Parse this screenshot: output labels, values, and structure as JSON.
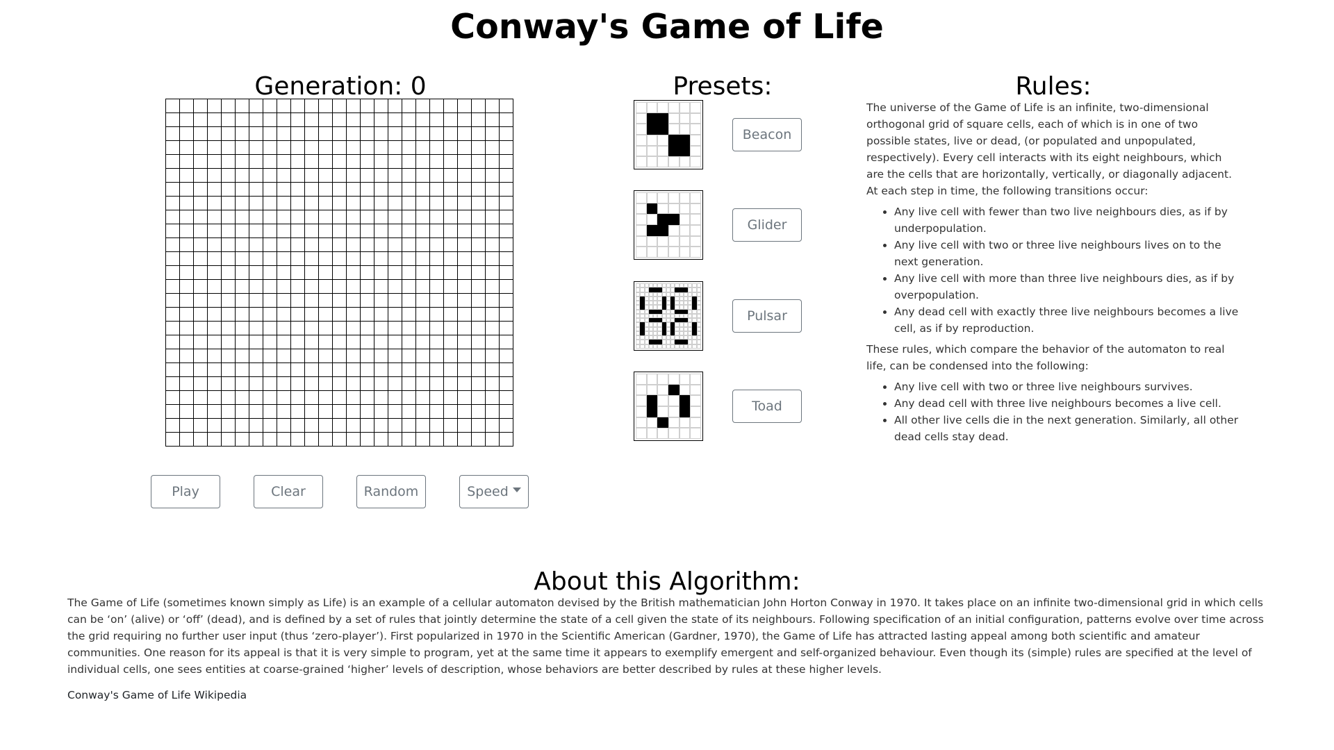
{
  "page": {
    "title": "Conway's Game of Life"
  },
  "game": {
    "generation_heading": "Generation: 0",
    "grid_rows": 25,
    "grid_cols": 25,
    "live_cells": []
  },
  "controls": {
    "play_label": "Play",
    "clear_label": "Clear",
    "random_label": "Random",
    "speed_label": "Speed"
  },
  "presets": {
    "heading": "Presets:",
    "items": [
      {
        "label": "Beacon",
        "rows": 6,
        "cols": 6,
        "cells": [
          [
            1,
            1
          ],
          [
            1,
            2
          ],
          [
            2,
            1
          ],
          [
            2,
            2
          ],
          [
            3,
            3
          ],
          [
            3,
            4
          ],
          [
            4,
            3
          ],
          [
            4,
            4
          ]
        ]
      },
      {
        "label": "Glider",
        "rows": 6,
        "cols": 6,
        "cells": [
          [
            1,
            1
          ],
          [
            2,
            2
          ],
          [
            2,
            3
          ],
          [
            3,
            1
          ],
          [
            3,
            2
          ]
        ]
      },
      {
        "label": "Pulsar",
        "rows": 15,
        "cols": 15,
        "cells": [
          [
            1,
            3
          ],
          [
            1,
            4
          ],
          [
            1,
            5
          ],
          [
            1,
            9
          ],
          [
            1,
            10
          ],
          [
            1,
            11
          ],
          [
            3,
            1
          ],
          [
            3,
            6
          ],
          [
            3,
            8
          ],
          [
            3,
            13
          ],
          [
            4,
            1
          ],
          [
            4,
            6
          ],
          [
            4,
            8
          ],
          [
            4,
            13
          ],
          [
            5,
            1
          ],
          [
            5,
            6
          ],
          [
            5,
            8
          ],
          [
            5,
            13
          ],
          [
            6,
            3
          ],
          [
            6,
            4
          ],
          [
            6,
            5
          ],
          [
            6,
            9
          ],
          [
            6,
            10
          ],
          [
            6,
            11
          ],
          [
            8,
            3
          ],
          [
            8,
            4
          ],
          [
            8,
            5
          ],
          [
            8,
            9
          ],
          [
            8,
            10
          ],
          [
            8,
            11
          ],
          [
            9,
            1
          ],
          [
            9,
            6
          ],
          [
            9,
            8
          ],
          [
            9,
            13
          ],
          [
            10,
            1
          ],
          [
            10,
            6
          ],
          [
            10,
            8
          ],
          [
            10,
            13
          ],
          [
            11,
            1
          ],
          [
            11,
            6
          ],
          [
            11,
            8
          ],
          [
            11,
            13
          ],
          [
            13,
            3
          ],
          [
            13,
            4
          ],
          [
            13,
            5
          ],
          [
            13,
            9
          ],
          [
            13,
            10
          ],
          [
            13,
            11
          ]
        ]
      },
      {
        "label": "Toad",
        "rows": 6,
        "cols": 6,
        "cells": [
          [
            1,
            3
          ],
          [
            2,
            1
          ],
          [
            2,
            4
          ],
          [
            3,
            1
          ],
          [
            3,
            4
          ],
          [
            4,
            2
          ]
        ]
      }
    ]
  },
  "rules": {
    "heading": "Rules:",
    "intro": "The universe of the Game of Life is an infinite, two-dimensional orthogonal grid of square cells, each of which is in one of two possible states, live or dead, (or populated and unpopulated, respectively). Every cell interacts with its eight neighbours, which are the cells that are horizontally, vertically, or diagonally adjacent. At each step in time, the following transitions occur:",
    "list1": [
      "Any live cell with fewer than two live neighbours dies, as if by underpopulation.",
      "Any live cell with two or three live neighbours lives on to the next generation.",
      "Any live cell with more than three live neighbours dies, as if by overpopulation.",
      "Any dead cell with exactly three live neighbours becomes a live cell, as if by reproduction."
    ],
    "middle": "These rules, which compare the behavior of the automaton to real life, can be condensed into the following:",
    "list2": [
      "Any live cell with two or three live neighbours survives.",
      "Any dead cell with three live neighbours becomes a live cell.",
      "All other live cells die in the next generation. Similarly, all other dead cells stay dead."
    ]
  },
  "about": {
    "heading": "About this Algorithm:",
    "body": "The Game of Life (sometimes known simply as Life) is an example of a cellular automaton devised by the British mathematician John Horton Conway in 1970. It takes place on an infinite two-dimensional grid in which cells can be ‘on’ (alive) or ‘off’ (dead), and is defined by a set of rules that jointly determine the state of a cell given the state of its neighbours. Following specification of an initial configuration, patterns evolve over time across the grid requiring no further user input (thus ‘zero-player’). First popularized in 1970 in the Scientific American (Gardner, 1970), the Game of Life has attracted lasting appeal among both scientific and amateur communities. One reason for its appeal is that it is very simple to program, yet at the same time it appears to exemplify emergent and self-organized behaviour. Even though its (simple) rules are specified at the level of individual cells, one sees entities at coarse-grained ‘higher’ levels of description, whose behaviors are better described by rules at these higher levels.",
    "wiki_link": "Conway's Game of Life Wikipedia"
  }
}
